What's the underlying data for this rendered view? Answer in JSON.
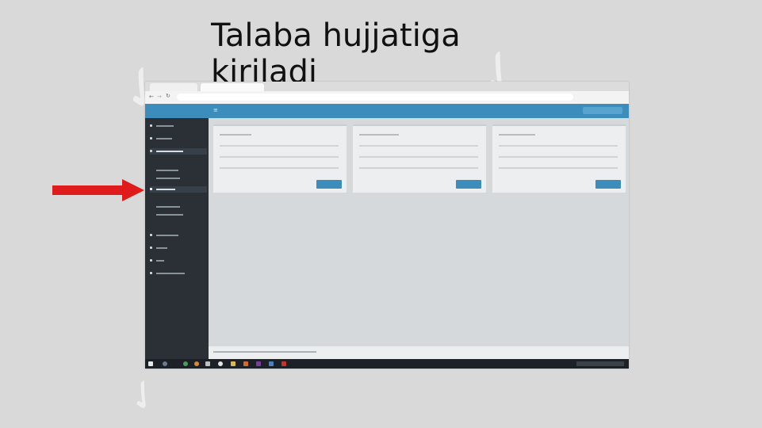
{
  "slide": {
    "title": "Talaba hujjatiga kiriladi"
  },
  "colors": {
    "background": "#d9d9d9",
    "arrow": "#e01b1b",
    "accent": "#3c8dbc",
    "sidebar": "#2a3036"
  },
  "screenshot": {
    "icons": [
      "back-icon",
      "forward-icon",
      "reload-icon",
      "windows-start-icon",
      "browser-icon",
      "folder-icon"
    ]
  }
}
